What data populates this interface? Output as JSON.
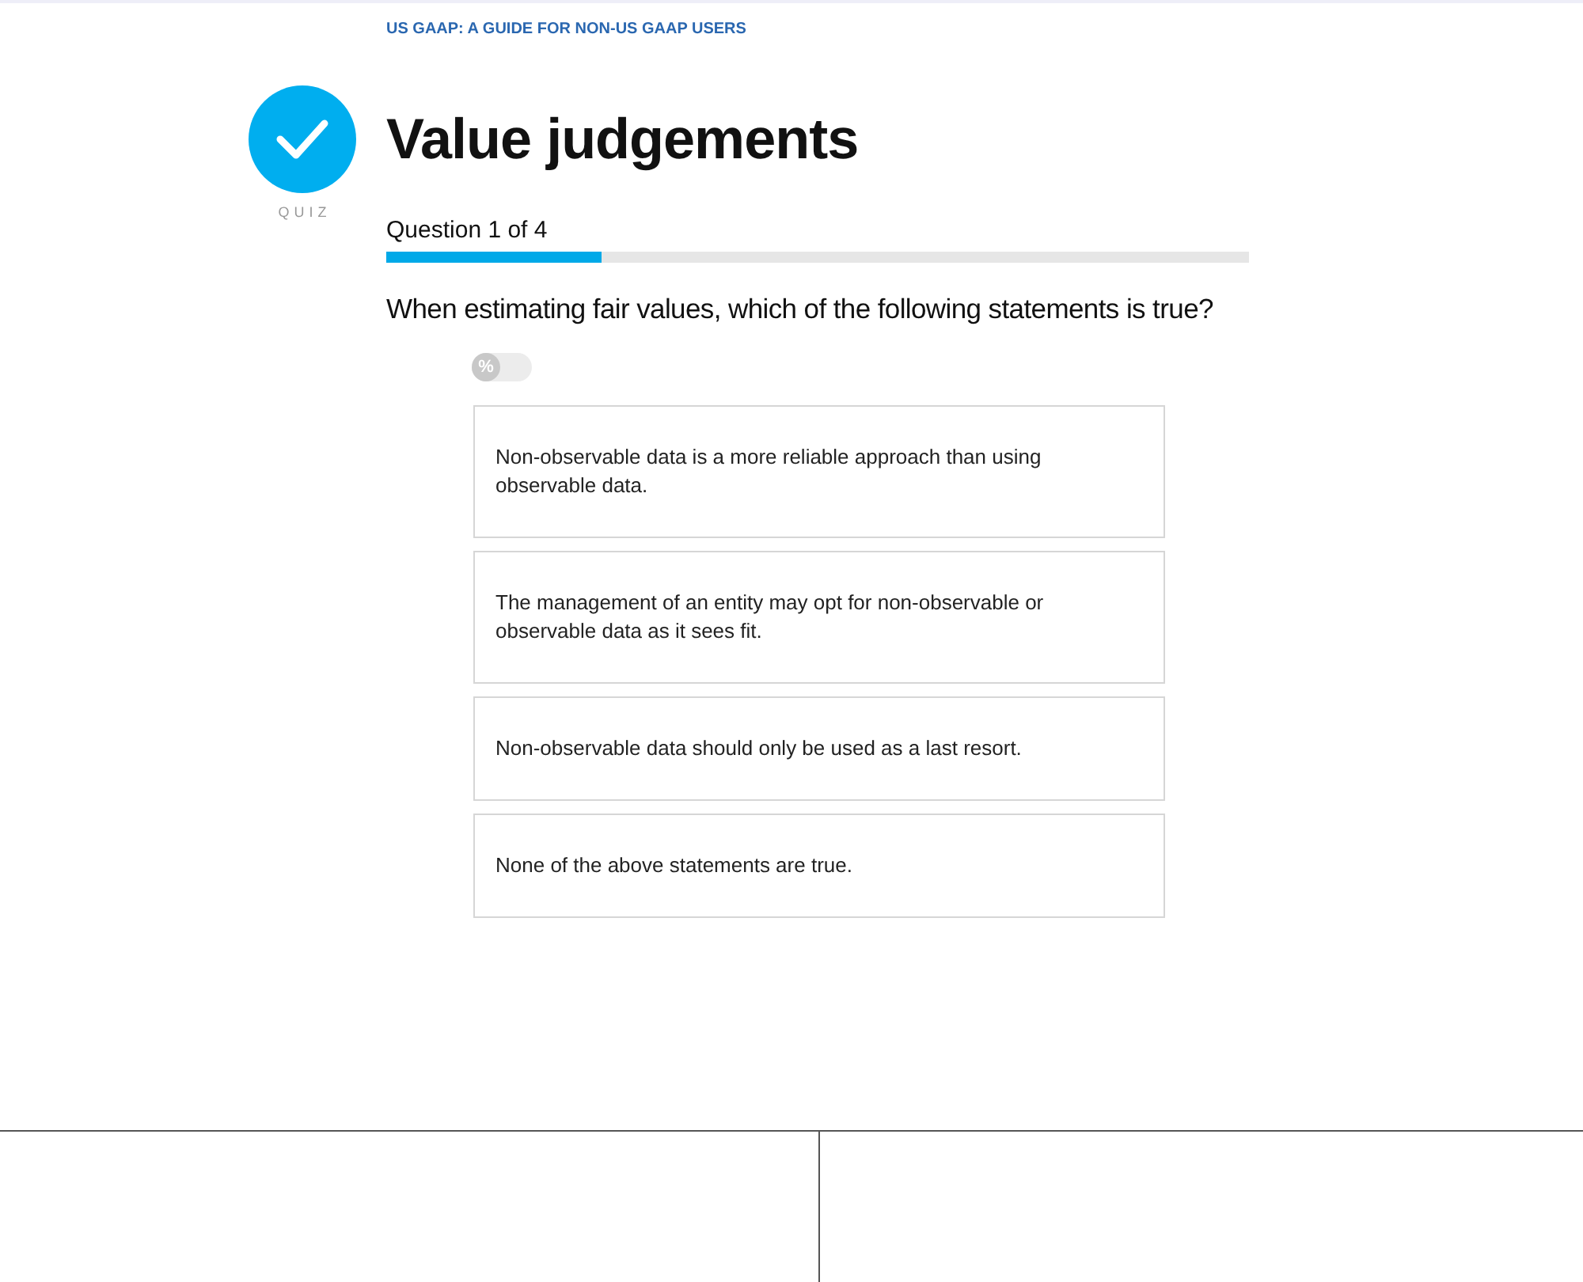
{
  "breadcrumb": "US GAAP: A GUIDE FOR NON-US GAAP USERS",
  "badge": {
    "label": "QUIZ"
  },
  "title": "Value judgements",
  "progress": {
    "label": "Question 1 of 4",
    "level": 0.25
  },
  "question": "When estimating fair values, which of the following statements is true?",
  "percent_toggle": {
    "icon_text": "%",
    "on": false
  },
  "options": [
    {
      "text": "Non-observable data is a more reliable approach than using observable data.",
      "selected": false
    },
    {
      "text": "The management of an entity may opt for non-observable or observable data as it sees fit.",
      "selected": false
    },
    {
      "text": "Non-observable data should only be used as a last resort.",
      "selected": false
    },
    {
      "text": "None of the above statements are true.",
      "selected": false
    }
  ]
}
